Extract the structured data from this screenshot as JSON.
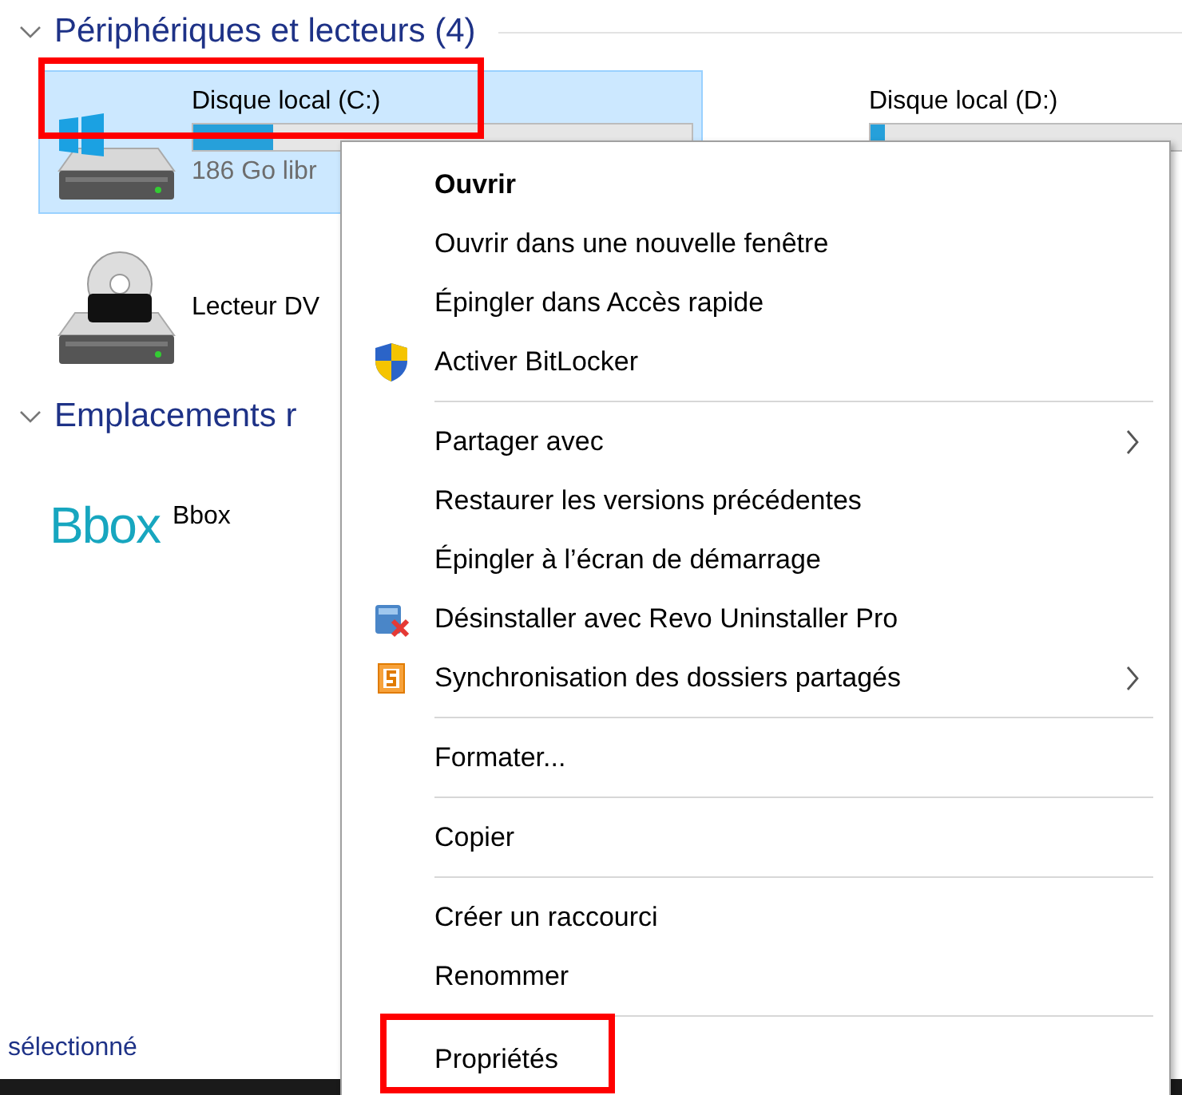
{
  "sections": [
    {
      "title": "Périphériques et lecteurs (4)",
      "expanded": true,
      "items": [
        {
          "kind": "drive",
          "name": "Disque local (C:)",
          "system": true,
          "selected": true,
          "highlighted": true,
          "level": 0.16,
          "free": "186 Go libr"
        },
        {
          "kind": "drive",
          "name": "Disque local (D:)",
          "system": false,
          "selected": false,
          "highlighted": false,
          "level": 0.03
        },
        {
          "kind": "dvd",
          "name": "Lecteur DV",
          "selected": false,
          "highlighted": false
        }
      ]
    },
    {
      "title": "Emplacements r",
      "expanded": true,
      "items": [
        {
          "kind": "network",
          "logo": "Bbox",
          "name": "Bbox",
          "selected": false,
          "highlighted": false
        }
      ]
    }
  ],
  "status_bar": {
    "text": "sélectionné"
  },
  "context_menu": {
    "items": [
      {
        "kind": "item",
        "label": "Ouvrir",
        "default": true,
        "submenu": false,
        "highlighted": false
      },
      {
        "kind": "item",
        "label": "Ouvrir dans une nouvelle fenêtre",
        "default": false,
        "submenu": false,
        "highlighted": false
      },
      {
        "kind": "item",
        "label": "Épingler dans Accès rapide",
        "default": false,
        "submenu": false,
        "highlighted": false
      },
      {
        "kind": "item",
        "label": "Activer BitLocker",
        "default": false,
        "submenu": false,
        "highlighted": false
      },
      {
        "kind": "separator"
      },
      {
        "kind": "item",
        "label": "Partager avec",
        "default": false,
        "submenu": true,
        "highlighted": false
      },
      {
        "kind": "item",
        "label": "Restaurer les versions précédentes",
        "default": false,
        "submenu": false,
        "highlighted": false
      },
      {
        "kind": "item",
        "label": "Épingler à l’écran de démarrage",
        "default": false,
        "submenu": false,
        "highlighted": false
      },
      {
        "kind": "item",
        "label": "Désinstaller avec Revo Uninstaller Pro",
        "default": false,
        "submenu": false,
        "highlighted": false
      },
      {
        "kind": "item",
        "label": "Synchronisation des dossiers partagés",
        "default": false,
        "submenu": true,
        "highlighted": false
      },
      {
        "kind": "separator"
      },
      {
        "kind": "item",
        "label": "Formater...",
        "default": false,
        "submenu": false,
        "highlighted": false
      },
      {
        "kind": "separator"
      },
      {
        "kind": "item",
        "label": "Copier",
        "default": false,
        "submenu": false,
        "highlighted": false
      },
      {
        "kind": "separator"
      },
      {
        "kind": "item",
        "label": "Créer un raccourci",
        "default": false,
        "submenu": false,
        "highlighted": false
      },
      {
        "kind": "item",
        "label": "Renommer",
        "default": false,
        "submenu": false,
        "highlighted": false
      },
      {
        "kind": "separator"
      },
      {
        "kind": "item",
        "label": "Propriétés",
        "default": false,
        "submenu": false,
        "highlighted": true
      }
    ]
  }
}
